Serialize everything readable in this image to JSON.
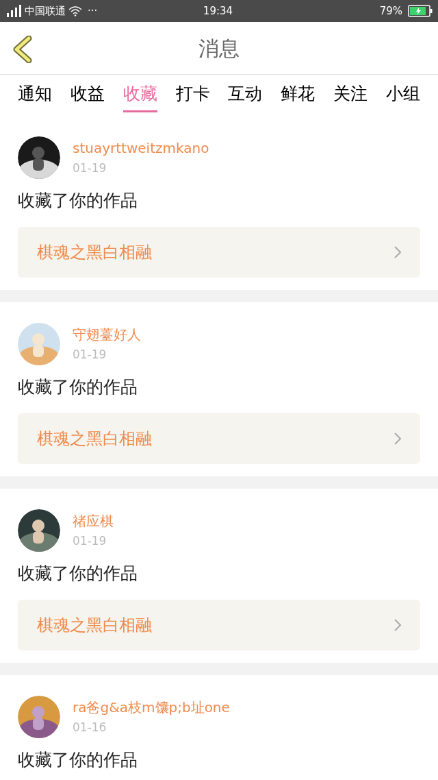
{
  "status_bar": {
    "carrier": "中国联通",
    "dots": "···",
    "time": "19:34",
    "battery": "79%"
  },
  "header": {
    "title": "消息"
  },
  "tabs": [
    {
      "label": "通知",
      "selected": false
    },
    {
      "label": "收益",
      "selected": false
    },
    {
      "label": "收藏",
      "selected": true
    },
    {
      "label": "打卡",
      "selected": false
    },
    {
      "label": "互动",
      "selected": false
    },
    {
      "label": "鲜花",
      "selected": false
    },
    {
      "label": "关注",
      "selected": false
    },
    {
      "label": "小组",
      "selected": false
    }
  ],
  "messages": [
    {
      "user": "stuayrttweitzmkano",
      "date": "01-19",
      "text": "收藏了你的作品",
      "work": "棋魂之黑白相融"
    },
    {
      "user": "守翅薹好人",
      "date": "01-19",
      "text": "收藏了你的作品",
      "work": "棋魂之黑白相融"
    },
    {
      "user": "禇应棋",
      "date": "01-19",
      "text": "收藏了你的作品",
      "work": "棋魂之黑白相融"
    },
    {
      "user": "ra爸g&a枝m馕p;b址one",
      "date": "01-16",
      "text": "收藏了你的作品"
    }
  ]
}
